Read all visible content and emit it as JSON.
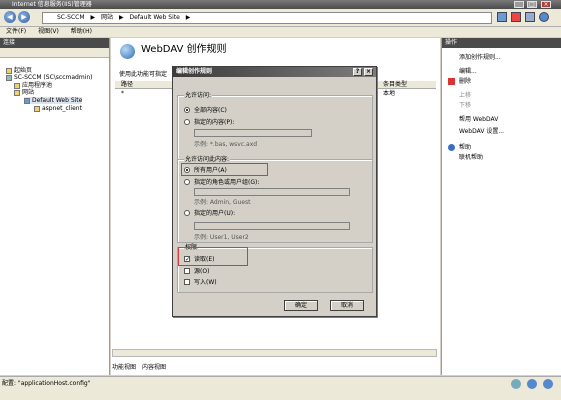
{
  "window": {
    "title": "Internet 信息服务(IIS)管理器",
    "min": "_",
    "max": "□",
    "close": "×"
  },
  "address": {
    "crumbs": [
      "SC-SCCM",
      "▶",
      "网站",
      "▶",
      "Default Web Site",
      "▶"
    ]
  },
  "menu": {
    "file": "文件(F)",
    "view": "视图(V)",
    "help": "帮助(H)"
  },
  "left": {
    "header": "连接",
    "tree": [
      "起始页",
      "SC-SCCM (SC\\sccmadmin)",
      "应用程序池",
      "网站",
      "Default Web Site",
      "aspnet_client"
    ]
  },
  "center": {
    "title": "WebDAV 创作规则",
    "description": "使用此功能可指定",
    "col_path": "路径",
    "row_path": "*",
    "col_type": "条目类型",
    "row_type": "本地"
  },
  "tabs": {
    "features": "功能视图",
    "content": "内容视图"
  },
  "right": {
    "header": "操作",
    "actions": [
      "添加创作规则...",
      "编辑...",
      "删除",
      "上移",
      "下移",
      "帮用 WebDAV",
      "WebDAV 设置...",
      "帮助",
      "联机帮助"
    ]
  },
  "status": {
    "text": "配置: \"applicationHost.config\""
  },
  "dialog": {
    "title": "编辑创作规则",
    "help": "?",
    "close": "×",
    "access_group": "允许访问:",
    "all_content": "全部内容(C)",
    "specified_content": "指定的内容(P):",
    "content_example": "示例: *.bas, wsvc.axd",
    "users_group": "允许访问此内容:",
    "all_users": "所有用户(A)",
    "specified_roles": "指定的角色或用户组(G):",
    "roles_example": "示例: Admin, Guest",
    "specified_users": "指定的用户(U):",
    "users_example": "示例: User1, User2",
    "perm_group": "权限",
    "read": "读取(E)",
    "source": "源(O)",
    "write": "写入(W)",
    "ok": "确定",
    "cancel": "取消"
  }
}
